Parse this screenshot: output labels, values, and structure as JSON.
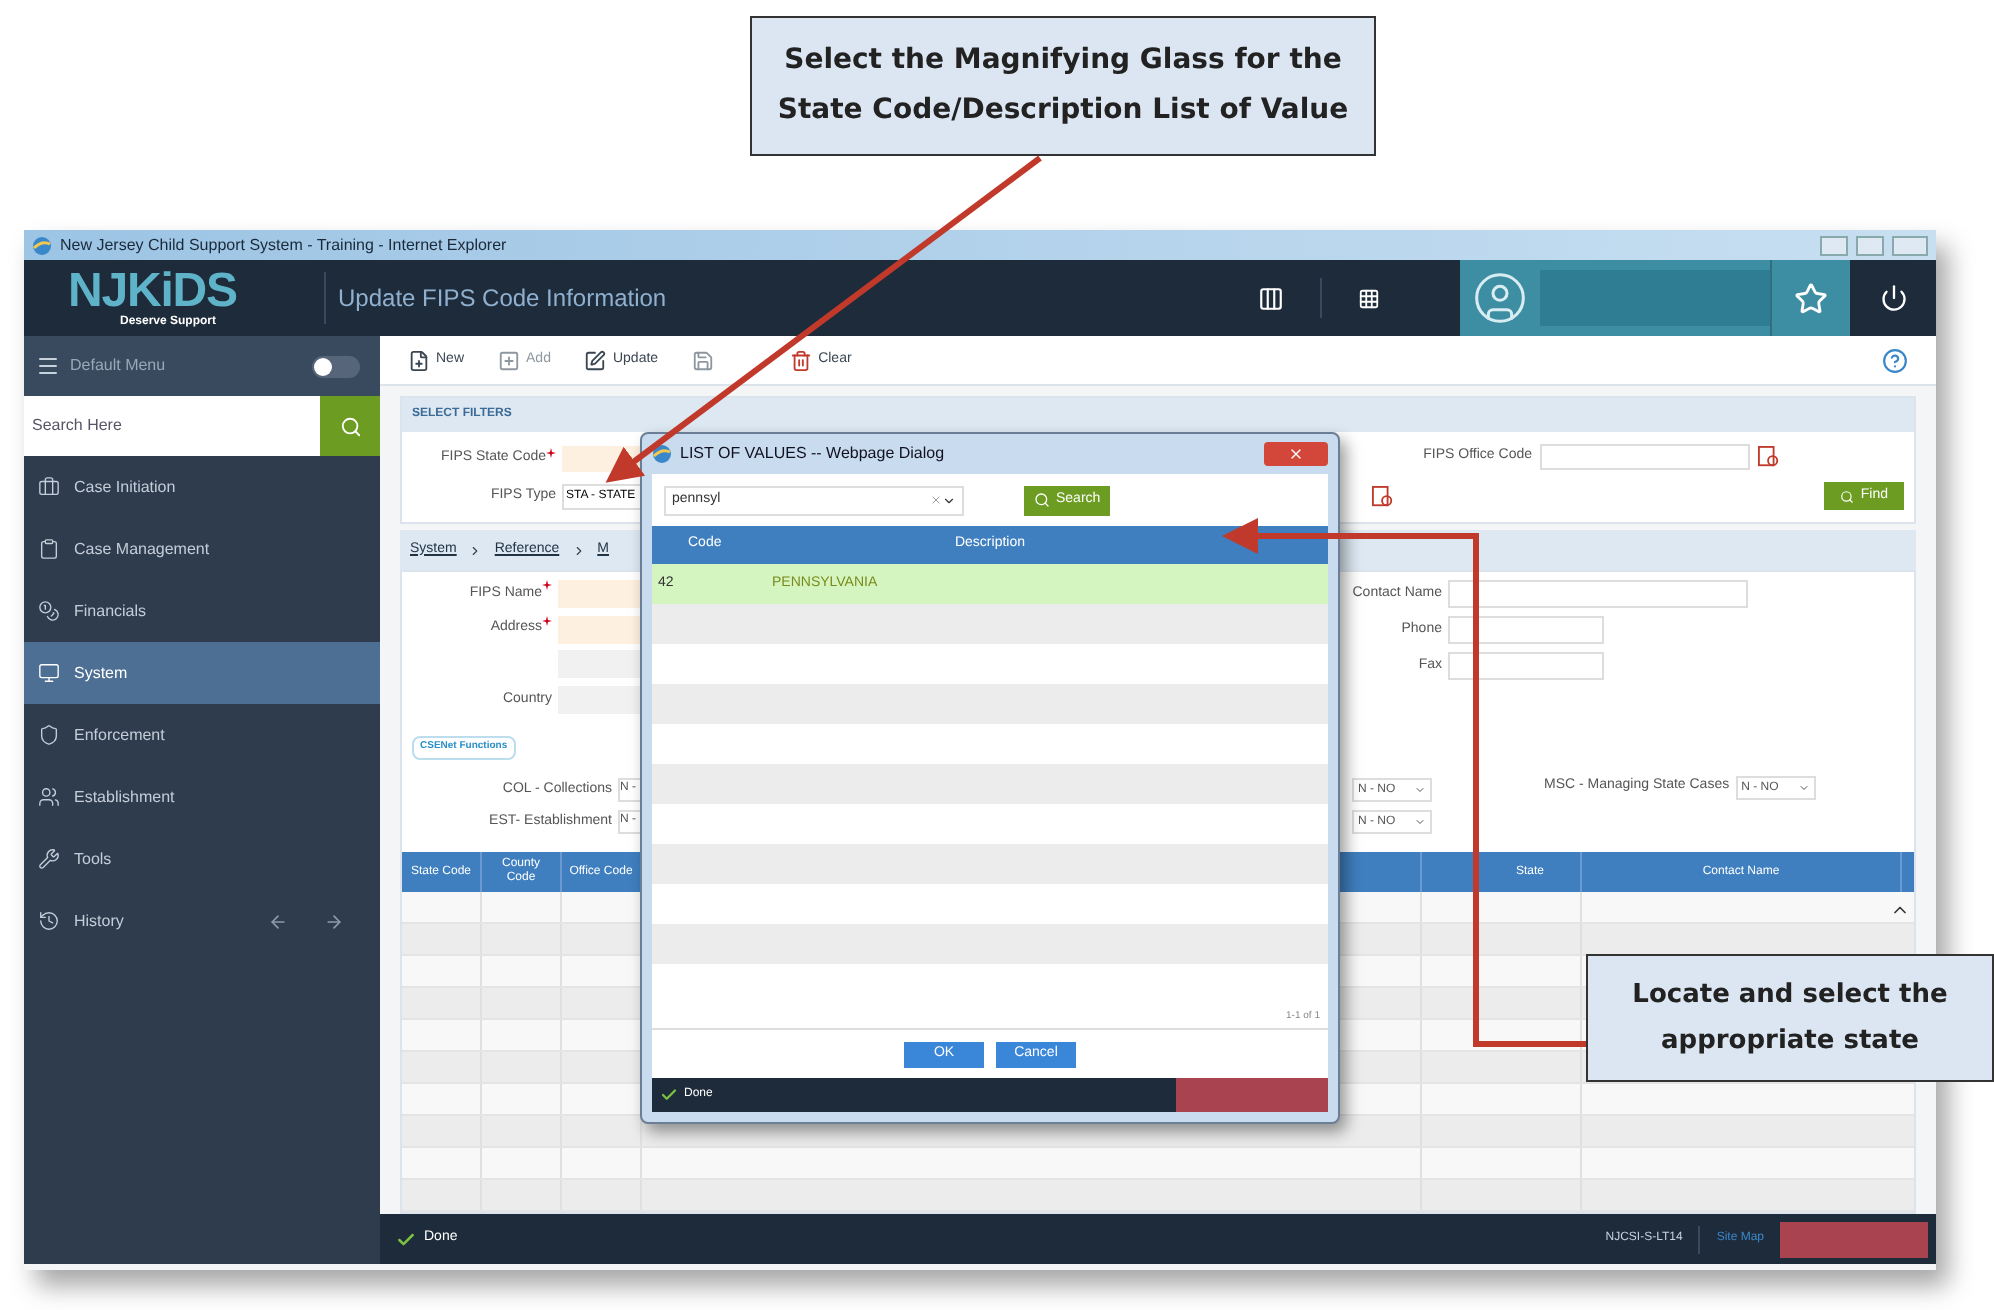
{
  "callouts": [
    {
      "text": "Select the Magnifying Glass for the State Code/Description List of Value"
    },
    {
      "text": "Locate and select the appropriate state"
    }
  ],
  "window": {
    "title": "New Jersey Child Support System - Training - Internet Explorer"
  },
  "header": {
    "logo": "NJKiDS",
    "tagline": "Deserve Support",
    "title": "Update FIPS Code Information"
  },
  "sidebar": {
    "menu_label": "Default Menu",
    "menu_toggle_on": false,
    "search_placeholder": "Search Here",
    "items": [
      {
        "label": "Case Initiation",
        "selected": false
      },
      {
        "label": "Case Management",
        "selected": false
      },
      {
        "label": "Financials",
        "selected": false
      },
      {
        "label": "System",
        "selected": true
      },
      {
        "label": "Enforcement",
        "selected": false
      },
      {
        "label": "Establishment",
        "selected": false
      },
      {
        "label": "Tools",
        "selected": false
      },
      {
        "label": "History",
        "selected": false
      }
    ]
  },
  "toolbar": [
    {
      "label": "New",
      "disabled": false
    },
    {
      "label": "Add",
      "disabled": true
    },
    {
      "label": "Update",
      "disabled": false
    },
    {
      "disabled": true
    },
    {
      "label": "Clear",
      "disabled": false
    }
  ],
  "filters": {
    "title": "SELECT FILTERS",
    "state_code": {
      "label": "FIPS State Code",
      "required": true
    },
    "type": {
      "label": "FIPS Type",
      "value": "STA - STATE"
    },
    "office_code": {
      "label": "FIPS Office Code"
    },
    "find_button": "Find"
  },
  "breadcrumb": [
    "System",
    "Reference",
    "M"
  ],
  "details": {
    "left": [
      {
        "label": "FIPS Name",
        "required": true
      },
      {
        "label": "Address",
        "required": true
      },
      {
        "required": false
      },
      {
        "label": "Country",
        "required": false
      }
    ],
    "right": [
      {
        "label": "Contact Name"
      },
      {
        "label": "Phone"
      },
      {
        "label": "Fax"
      }
    ],
    "csenet_tag": "CSENet Functions",
    "functions_left": [
      {
        "label": "COL - Collections",
        "value": "N -"
      },
      {
        "label": "EST- Establishment",
        "value": "N -"
      }
    ],
    "functions_mid": [
      "N - NO",
      "N - NO"
    ],
    "msc": {
      "label": "MSC - Managing State Cases",
      "value": "N - NO"
    }
  },
  "grid": {
    "columns_left": [
      "State Code",
      "County Code",
      "Office Code"
    ],
    "columns_right": [
      "State",
      "Contact Name"
    ]
  },
  "status_bar": {
    "status": "Done",
    "machine": "NJCSI-S-LT14",
    "site_map": "Site Map"
  },
  "dialog": {
    "title": "LIST OF VALUES -- Webpage Dialog",
    "search_value": "pennsyl",
    "search_button": "Search",
    "columns": [
      "Code",
      "Description"
    ],
    "rows": [
      {
        "code": "42",
        "description": "PENNSYLVANIA",
        "selected": true
      }
    ],
    "pager": "1-1 of 1",
    "buttons": [
      "OK",
      "Cancel"
    ],
    "status": "Done"
  }
}
